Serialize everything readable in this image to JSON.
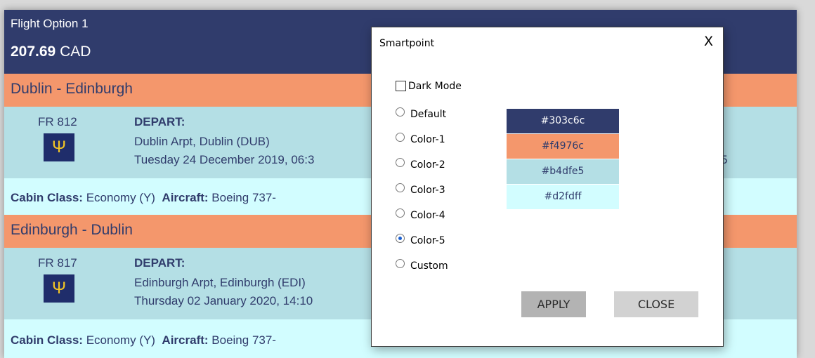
{
  "option": {
    "label": "Flight Option 1",
    "price_amount": "207.69",
    "price_currency": "CAD"
  },
  "legs": [
    {
      "route": "Dublin - Edinburgh",
      "flight_no": "FR 812",
      "airline_logo_icon": "ryanair-harp-icon",
      "depart_label": "DEPART:",
      "airport": "Dublin Arpt, Dublin (DUB)",
      "datetime": "Tuesday 24 December 2019, 06:3",
      "trailing": "5",
      "info": {
        "cabin_label": "Cabin Class:",
        "cabin_value": "Economy (Y)",
        "aircraft_label": "Aircraft:",
        "aircraft_value": "Boeing 737-"
      }
    },
    {
      "route": "Edinburgh - Dublin",
      "flight_no": "FR 817",
      "airline_logo_icon": "ryanair-harp-icon",
      "depart_label": "DEPART:",
      "airport": "Edinburgh Arpt, Edinburgh (EDI)",
      "datetime": "Thursday 02 January 2020, 14:10",
      "info": {
        "cabin_label": "Cabin Class:",
        "cabin_value": "Economy (Y)",
        "aircraft_label": "Aircraft:",
        "aircraft_value": "Boeing 737-"
      }
    }
  ],
  "dialog": {
    "title": "Smartpoint",
    "close_glyph": "X",
    "dark_mode_label": "Dark Mode",
    "dark_mode_checked": false,
    "color_options": [
      "Default",
      "Color-1",
      "Color-2",
      "Color-3",
      "Color-4",
      "Color-5",
      "Custom"
    ],
    "selected_option": "Color-5",
    "swatches": [
      {
        "hex": "#303c6c",
        "text_color": "#ffffff"
      },
      {
        "hex": "#f4976c",
        "text_color": "#303c6c"
      },
      {
        "hex": "#b4dfe5",
        "text_color": "#303c6c"
      },
      {
        "hex": "#d2fdff",
        "text_color": "#303c6c"
      }
    ],
    "apply_label": "APPLY",
    "close_label": "CLOSE"
  },
  "colors": {
    "header_bg": "#303c6c",
    "route_bg": "#f4976c",
    "segment_bg": "#b4dfe5",
    "info_bg": "#d2fdff",
    "text": "#303c6c"
  }
}
